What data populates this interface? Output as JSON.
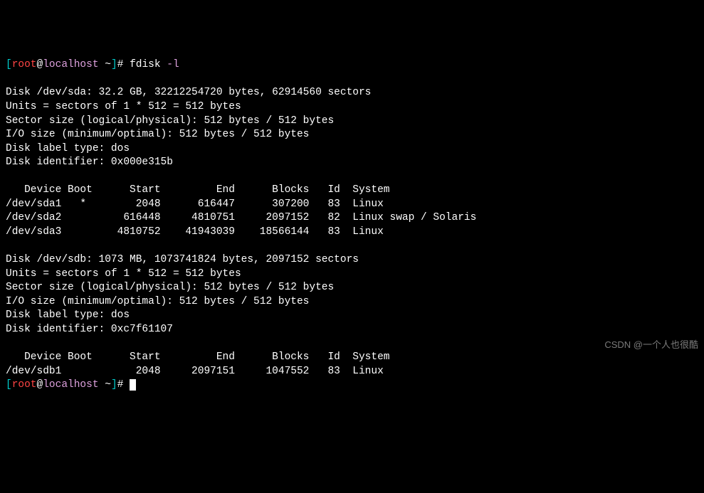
{
  "prompt1": {
    "lb": "[",
    "user": "root",
    "at": "@",
    "host": "localhost",
    "path": " ~",
    "rb": "]",
    "hash": "# ",
    "cmd": "fdisk ",
    "flag": "-l"
  },
  "blank": "",
  "sda": {
    "l1": "Disk /dev/sda: 32.2 GB, 32212254720 bytes, 62914560 sectors",
    "l2": "Units = sectors of 1 * 512 = 512 bytes",
    "l3": "Sector size (logical/physical): 512 bytes / 512 bytes",
    "l4": "I/O size (minimum/optimal): 512 bytes / 512 bytes",
    "l5": "Disk label type: dos",
    "l6": "Disk identifier: 0x000e315b"
  },
  "sda_header": "   Device Boot      Start         End      Blocks   Id  System",
  "sda_row1": "/dev/sda1   *        2048      616447      307200   83  Linux",
  "sda_row2": "/dev/sda2          616448     4810751     2097152   82  Linux swap / Solaris",
  "sda_row3": "/dev/sda3         4810752    41943039    18566144   83  Linux",
  "sdb": {
    "l1": "Disk /dev/sdb: 1073 MB, 1073741824 bytes, 2097152 sectors",
    "l2": "Units = sectors of 1 * 512 = 512 bytes",
    "l3": "Sector size (logical/physical): 512 bytes / 512 bytes",
    "l4": "I/O size (minimum/optimal): 512 bytes / 512 bytes",
    "l5": "Disk label type: dos",
    "l6": "Disk identifier: 0xc7f61107"
  },
  "sdb_header": "   Device Boot      Start         End      Blocks   Id  System",
  "sdb_row1": "/dev/sdb1            2048     2097151     1047552   83  Linux",
  "prompt2": {
    "lb": "[",
    "user": "root",
    "at": "@",
    "host": "localhost",
    "path": " ~",
    "rb": "]",
    "hash": "# "
  },
  "watermark": "CSDN @一个人也很酷"
}
